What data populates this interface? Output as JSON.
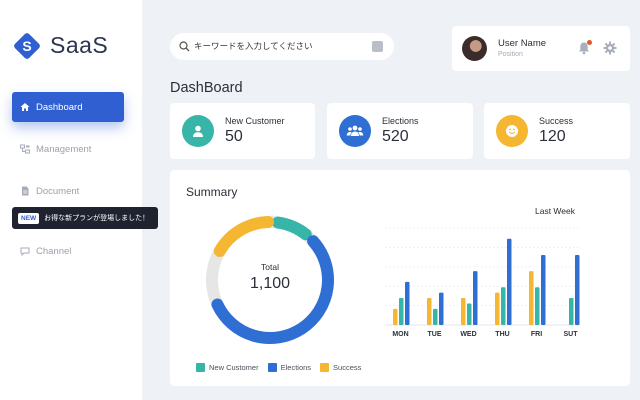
{
  "brand": {
    "logo_letter": "S",
    "name": "SaaS"
  },
  "sidebar": {
    "items": [
      {
        "label": "Dashboard",
        "icon": "home-icon",
        "active": true
      },
      {
        "label": "Management",
        "icon": "org-chart-icon",
        "active": false
      },
      {
        "label": "Document",
        "icon": "document-icon",
        "active": false
      },
      {
        "label": "Channel",
        "icon": "channel-icon",
        "active": false
      }
    ]
  },
  "tooltip": {
    "badge": "NEW",
    "text": "お得な新プランが登場しました！"
  },
  "search": {
    "placeholder": "キーワードを入力してください",
    "value": ""
  },
  "user": {
    "name": "User Name",
    "position": "Position"
  },
  "page": {
    "title": "DashBoard"
  },
  "stats": [
    {
      "label": "New Customer",
      "value": "50",
      "color": "#36b5a8",
      "icon": "person-icon"
    },
    {
      "label": "Elections",
      "value": "520",
      "color": "#2f6fd3",
      "icon": "group-icon"
    },
    {
      "label": "Success",
      "value": "120",
      "color": "#f5b731",
      "icon": "smile-icon"
    }
  ],
  "summary": {
    "title": "Summary",
    "total_label": "Total",
    "total_value": "1,100"
  },
  "colors": {
    "accent": "#2f5fd0",
    "teal": "#36b5a8",
    "blue": "#2f6fd3",
    "yellow": "#f5b731",
    "track": "#e6e6e6"
  },
  "chart_data": [
    {
      "type": "pie",
      "variant": "donut",
      "categories": [
        "New Customer",
        "Elections",
        "Success"
      ],
      "values": [
        50,
        520,
        120
      ],
      "legend": [
        "New Customer",
        "Elections",
        "Success"
      ],
      "legend_position": "bottom"
    },
    {
      "type": "bar",
      "title": "Last Week",
      "categories": [
        "MON",
        "TUE",
        "WED",
        "THU",
        "FRI",
        "SUT"
      ],
      "series": [
        {
          "name": "Success",
          "values": [
            15,
            25,
            25,
            30,
            50,
            0
          ]
        },
        {
          "name": "New Customer",
          "values": [
            25,
            15,
            20,
            35,
            35,
            25
          ]
        },
        {
          "name": "Elections",
          "values": [
            40,
            30,
            50,
            80,
            65,
            65
          ]
        }
      ],
      "ylim": [
        0,
        90
      ],
      "grid": true
    }
  ]
}
